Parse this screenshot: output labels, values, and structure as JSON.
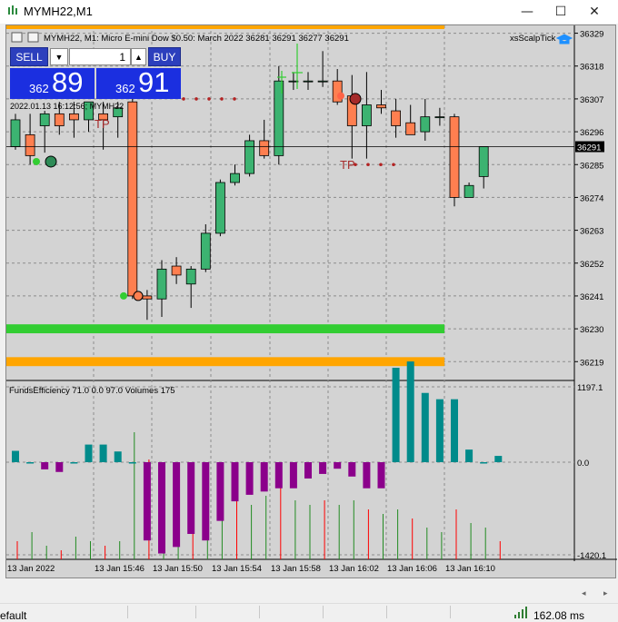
{
  "window": {
    "title": "MYMH22,M1",
    "minimize_glyph": "—",
    "maximize_glyph": "☐",
    "close_glyph": "✕",
    "icon": "chart-window-icon"
  },
  "chart": {
    "header": "MYMH22, M1:  Micro E-mini Dow $0.50: March 2022  36281 36291 36277 36291",
    "indicator_label": "xsScalpTick",
    "timestamp_label": "2022.01.13 16:12:56; MYMH22",
    "tp_label": "TP",
    "current_price_label": "36291",
    "price_axis": [
      "36329",
      "36318",
      "36307",
      "36296",
      "36285",
      "36274",
      "36263",
      "36252",
      "36241",
      "36230",
      "36219"
    ],
    "sub_title": "FundsEfficiency 71.0 0.0 97.0 Volumes 175",
    "sub_axis": [
      "1197.1",
      "0.0",
      "-1420.1"
    ],
    "time_axis": [
      "13 Jan 2022",
      "13 Jan 15:46",
      "13 Jan 15:50",
      "13 Jan 15:54",
      "13 Jan 15:58",
      "13 Jan 16:02",
      "13 Jan 16:06",
      "13 Jan 16:10"
    ],
    "colors": {
      "bull": "#3cb371",
      "bear": "#ff7f50",
      "bg": "#d3d3d3",
      "green_band": "#32cd32",
      "orange_band": "#ffa500",
      "hist_pos": "#008b8b",
      "hist_neg": "#8b008b"
    }
  },
  "trade_panel": {
    "sell_label": "SELL",
    "buy_label": "BUY",
    "lot_value": "1",
    "dropdown_glyph": "▼",
    "up_glyph": "▲",
    "sell_price_small": "362",
    "sell_price_big": "89",
    "buy_price_small": "362",
    "buy_price_big": "91"
  },
  "scroll": {
    "left_glyph": "◂",
    "right_glyph": "▸"
  },
  "status": {
    "profile": "efault",
    "ping": "162.08 ms"
  },
  "chart_data": {
    "type": "candlestick",
    "ylim": [
      36213,
      36331
    ],
    "candles": [
      {
        "o": 36291,
        "h": 36302,
        "l": 36290,
        "c": 36300
      },
      {
        "o": 36295,
        "h": 36302,
        "l": 36285,
        "c": 36288
      },
      {
        "o": 36298,
        "h": 36303,
        "l": 36289,
        "c": 36302
      },
      {
        "o": 36302,
        "h": 36306,
        "l": 36295,
        "c": 36298
      },
      {
        "o": 36302,
        "h": 36306,
        "l": 36294,
        "c": 36300
      },
      {
        "o": 36300,
        "h": 36306,
        "l": 36296,
        "c": 36306
      },
      {
        "o": 36302,
        "h": 36306,
        "l": 36290,
        "c": 36300
      },
      {
        "o": 36301,
        "h": 36306,
        "l": 36294,
        "c": 36304
      },
      {
        "o": 36306,
        "h": 36308,
        "l": 36240,
        "c": 36241
      },
      {
        "o": 36241,
        "h": 36243,
        "l": 36233,
        "c": 36240
      },
      {
        "o": 36240,
        "h": 36253,
        "l": 36234,
        "c": 36250
      },
      {
        "o": 36251,
        "h": 36254,
        "l": 36245,
        "c": 36248
      },
      {
        "o": 36245,
        "h": 36251,
        "l": 36237,
        "c": 36250
      },
      {
        "o": 36250,
        "h": 36265,
        "l": 36249,
        "c": 36262
      },
      {
        "o": 36262,
        "h": 36280,
        "l": 36261,
        "c": 36279
      },
      {
        "o": 36279,
        "h": 36285,
        "l": 36278,
        "c": 36282
      },
      {
        "o": 36282,
        "h": 36295,
        "l": 36281,
        "c": 36293
      },
      {
        "o": 36293,
        "h": 36300,
        "l": 36287,
        "c": 36288
      },
      {
        "o": 36288,
        "h": 36318,
        "l": 36285,
        "c": 36313
      },
      {
        "o": 36313,
        "h": 36316,
        "l": 36310,
        "c": 36313
      },
      {
        "o": 36313,
        "h": 36316,
        "l": 36310,
        "c": 36313
      },
      {
        "o": 36313,
        "h": 36323,
        "l": 36311,
        "c": 36313
      },
      {
        "o": 36313,
        "h": 36317,
        "l": 36305,
        "c": 36306
      },
      {
        "o": 36308,
        "h": 36315,
        "l": 36287,
        "c": 36298
      },
      {
        "o": 36298,
        "h": 36316,
        "l": 36287,
        "c": 36305
      },
      {
        "o": 36305,
        "h": 36310,
        "l": 36302,
        "c": 36304
      },
      {
        "o": 36303,
        "h": 36307,
        "l": 36294,
        "c": 36298
      },
      {
        "o": 36299,
        "h": 36305,
        "l": 36295,
        "c": 36295
      },
      {
        "o": 36296,
        "h": 36307,
        "l": 36293,
        "c": 36301
      },
      {
        "o": 36301,
        "h": 36304,
        "l": 36298,
        "c": 36301
      },
      {
        "o": 36301,
        "h": 36302,
        "l": 36271,
        "c": 36274
      },
      {
        "o": 36274,
        "h": 36279,
        "l": 36274,
        "c": 36278
      },
      {
        "o": 36281,
        "h": 36291,
        "l": 36277,
        "c": 36291
      }
    ],
    "histogram": [
      180,
      0,
      -110,
      -150,
      0,
      280,
      280,
      170,
      0,
      -1200,
      -1400,
      -1300,
      -1100,
      -1200,
      -900,
      -600,
      -500,
      -450,
      -400,
      -400,
      -250,
      -180,
      -100,
      -220,
      -400,
      -400,
      1500,
      1600,
      1100,
      1000,
      1000,
      200,
      0,
      100
    ],
    "volumes": [
      400,
      600,
      300,
      200,
      500,
      400,
      300,
      400,
      2800,
      2200,
      1800,
      2000,
      1700,
      1900,
      1700,
      1500,
      1200,
      1400,
      1600,
      1300,
      1200,
      1300,
      1200,
      1300,
      1100,
      1000,
      1100,
      900,
      700,
      600,
      1100,
      800,
      700,
      400
    ]
  }
}
